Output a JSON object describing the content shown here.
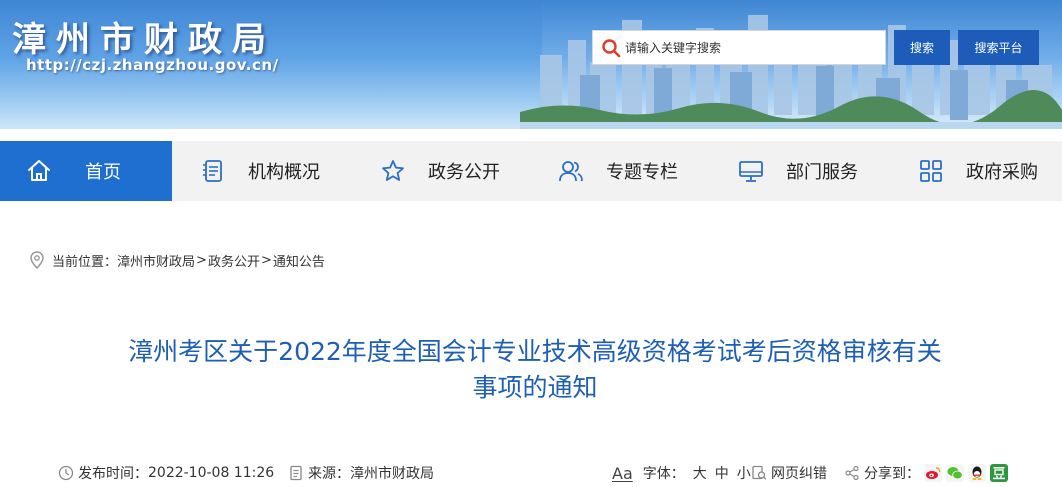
{
  "header": {
    "site_title": "漳州市财政局",
    "site_url": "http://czj.zhangzhou.gov.cn/",
    "search": {
      "placeholder": "请输入关键字搜索",
      "search_button": "搜索",
      "platform_button": "搜索平台"
    }
  },
  "nav": {
    "items": [
      {
        "label": "首页",
        "icon": "home-icon",
        "active": true
      },
      {
        "label": "机构概况",
        "icon": "document-list-icon"
      },
      {
        "label": "政务公开",
        "icon": "star-icon"
      },
      {
        "label": "专题专栏",
        "icon": "users-icon"
      },
      {
        "label": "部门服务",
        "icon": "monitor-icon"
      },
      {
        "label": "政府采购",
        "icon": "grid-icon"
      }
    ]
  },
  "breadcrumb": {
    "prefix": "当前位置：",
    "items": [
      "漳州市财政局",
      "政务公开",
      "通知公告"
    ],
    "separator": ">"
  },
  "article": {
    "title_line1": "漳州考区关于2022年度全国会计专业技术高级资格考试考后资格审核有关",
    "title_line2": "事项的通知",
    "publish_label": "发布时间：",
    "publish_time": "2022-10-08 11:26",
    "source_label": "来源：",
    "source": "漳州市财政局",
    "font_label": "字体：",
    "font_sizes": [
      "大",
      "中",
      "小"
    ],
    "font_icon_text": "Aa",
    "error_link": "网页纠错",
    "share_label": "分享到：",
    "share_targets": [
      "weibo-icon",
      "wechat-icon",
      "qq-icon",
      "douban-icon"
    ]
  },
  "colors": {
    "primary_blue": "#1f6fd1",
    "button_blue": "#1d5cb8",
    "title_blue": "#1e5fb3",
    "search_icon_red": "#e23b2e"
  }
}
